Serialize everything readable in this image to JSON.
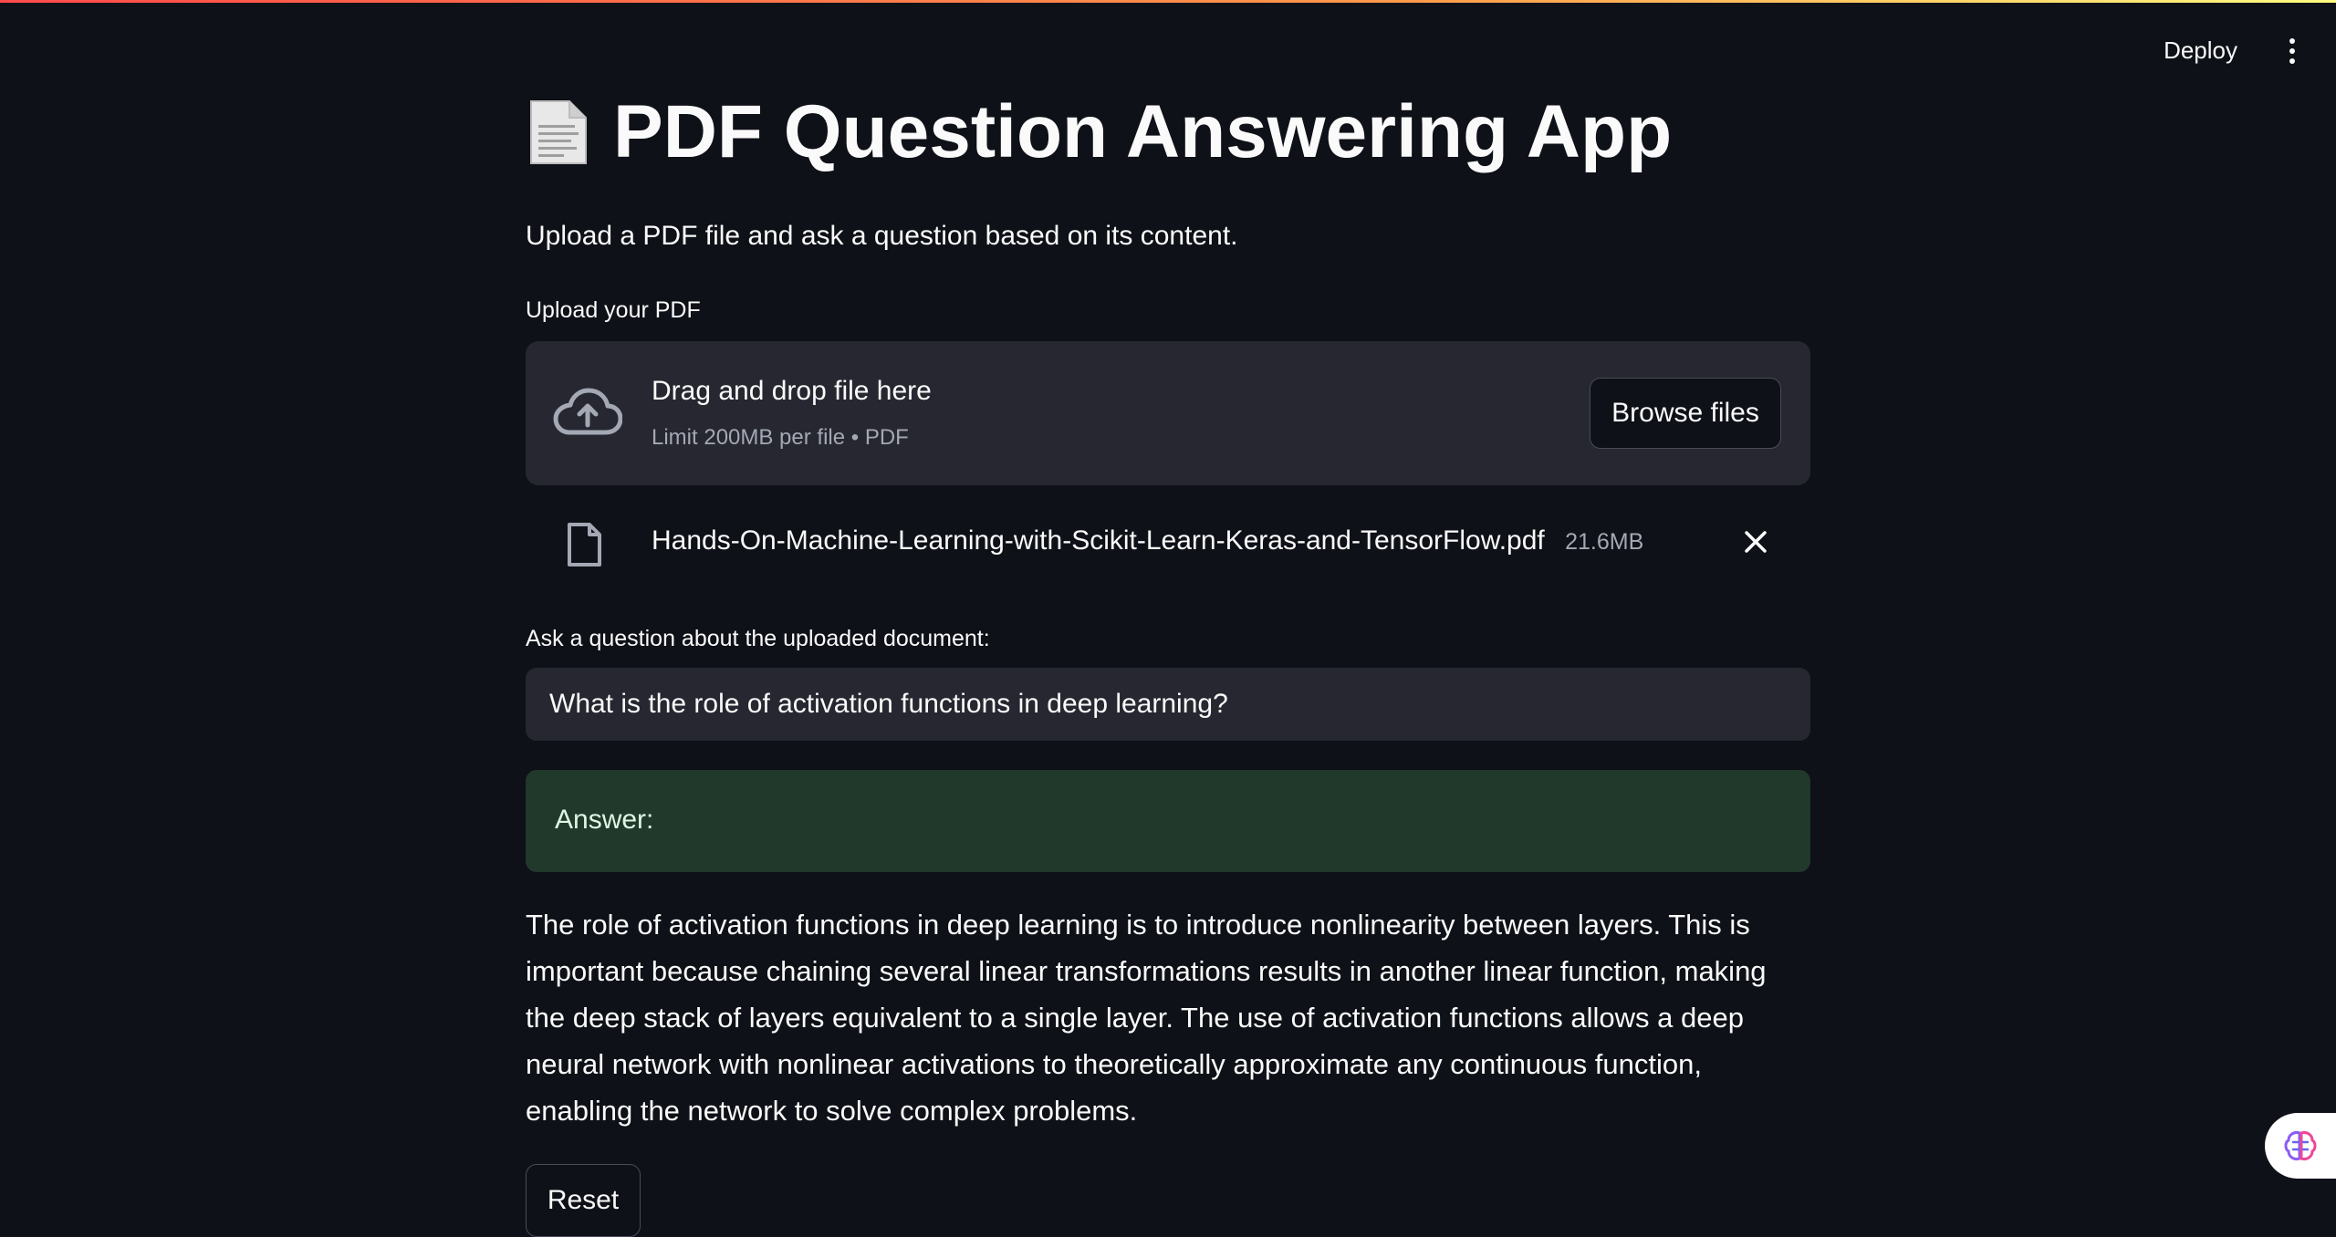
{
  "header": {
    "deploy_label": "Deploy",
    "menu_icon": "vertical-dots-icon",
    "gradient_colors": [
      "#ff4b4b",
      "#ff9a4b",
      "#fffd80"
    ]
  },
  "app": {
    "title_icon": "page-facing-up-emoji",
    "title": "PDF Question Answering App",
    "subtitle": "Upload a PDF file and ask a question based on its content."
  },
  "uploader": {
    "label": "Upload your PDF",
    "icon": "cloud-upload-icon",
    "dropzone_text": "Drag and drop file here",
    "limit_text": "Limit 200MB per file • PDF",
    "browse_label": "Browse files",
    "file": {
      "icon": "file-icon",
      "name": "Hands-On-Machine-Learning-with-Scikit-Learn-Keras-and-TensorFlow.pdf",
      "size": "21.6MB",
      "remove_icon": "close-icon"
    }
  },
  "question": {
    "label": "Ask a question about the uploaded document:",
    "value": "What is the role of activation functions in deep learning?"
  },
  "answer": {
    "label": "Answer:",
    "text": "The role of activation functions in deep learning is to introduce nonlinearity between layers. This is important because chaining several linear transformations results in another linear function, making the deep stack of layers equivalent to a single layer. The use of activation functions allows a deep neural network with nonlinear activations to theoretically approximate any continuous function, enabling the network to solve complex problems.",
    "box_color": "#21392b"
  },
  "reset_label": "Reset",
  "floating_widget_icon": "brain-icon",
  "colors": {
    "background": "#0e1117",
    "surface": "#262730",
    "text": "#fafafa",
    "muted": "#a3a8b4"
  }
}
